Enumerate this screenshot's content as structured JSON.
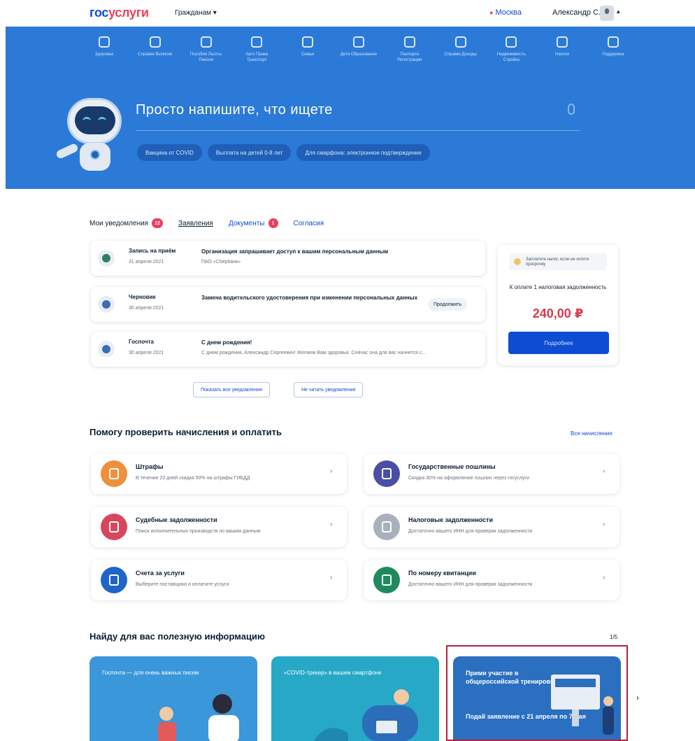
{
  "header": {
    "logo_a": "гос",
    "logo_b": "услуги",
    "dropdown": "Гражданам ▾",
    "city": "Москва",
    "user": "Александр С."
  },
  "hero": {
    "categories": [
      "Здоровье",
      "Справки Выписки",
      "Пособия Льготы Пенсии",
      "Авто Права Транспорт",
      "Семья",
      "Дети Образование",
      "Паспорта Регистрации",
      "Справки Доходы",
      "Недвижимость Стройка",
      "Налоги",
      "Поддержка"
    ],
    "search_placeholder": "Просто напишите, что ищете",
    "chips": [
      "Вакцина от COVID",
      "Выплата на детей 0-8 лет",
      "Для смарфона: электронное подтверждение"
    ]
  },
  "notifications": {
    "tabs": [
      {
        "label": "Мои уведомления",
        "badge": "12"
      },
      {
        "label": "Заявления"
      },
      {
        "label": "Документы",
        "badge": "1"
      },
      {
        "label": "Согласия"
      }
    ],
    "items": [
      {
        "who": "Запись на приём",
        "date": "31 апреля 2021",
        "title": "Организация запрашивает доступ к вашим персональным данным",
        "sub": "ПАО «Сбербанк»",
        "action": ""
      },
      {
        "who": "Черновик",
        "date": "30 апреля 2021",
        "title": "Замена водительского удостоверения при изменении персональных данных",
        "sub": "",
        "action": "Продолжить"
      },
      {
        "who": "Госпочта",
        "date": "30 апреля 2021",
        "title": "С днем рождения!",
        "sub": "С днем рождения, Александр Сергеевич! Желаем Вам здоровья. Сейчас она для вас начнется с...",
        "action": ""
      }
    ],
    "show_all": "Показать все уведомления",
    "mark_read": "Не читать уведомления"
  },
  "tax": {
    "hint": "Заплатите налог, если не хотите просрочку",
    "text": "К оплате 1 налоговая задолженность",
    "amount": "240,00 ₽",
    "pay": "Подробнее"
  },
  "payments": {
    "title": "Помогу проверить начисления и оплатить",
    "all": "Все начисления",
    "cards": [
      {
        "title": "Штрафы",
        "desc": "В течение 20 дней скидка 50% на штрафы ГИБДД",
        "color": "#ef8f3c",
        "icon": "fine-icon"
      },
      {
        "title": "Государственные пошлины",
        "desc": "Скидка 30% на оформление пошлин через госуслуги",
        "color": "#4b4ea6",
        "icon": "duty-icon"
      },
      {
        "title": "Судебные задолженности",
        "desc": "Поиск исполнительных производств по вашим данным",
        "color": "#d9465b",
        "icon": "scales-icon"
      },
      {
        "title": "Налоговые задолженности",
        "desc": "Достаточно вашего ИНН для проверки задолженности",
        "color": "#a9b0bd",
        "icon": "tax-doc-icon"
      },
      {
        "title": "Счета за услуги",
        "desc": "Выберите поставщика и оплатите услуги",
        "color": "#1f64c8",
        "icon": "bill-icon"
      },
      {
        "title": "По номеру квитанции",
        "desc": "Достаточно вашего ИНН для проверки задолженности",
        "color": "#1f8a5e",
        "icon": "receipt-icon"
      }
    ]
  },
  "info": {
    "title": "Найду для вас полезную информацию",
    "counter": "1/5",
    "tiles": [
      {
        "text": "Госпочта — для очень важных писем",
        "color": "#3a97d9"
      },
      {
        "text": "«COVID-трекер» в вашем смартфоне",
        "color": "#27a8c7"
      },
      {
        "text": "Прими участие в общероссийской тренировке",
        "text2": "Подай заявление с 21 апреля по 7 мая",
        "color": "#2a6fc0"
      }
    ]
  }
}
